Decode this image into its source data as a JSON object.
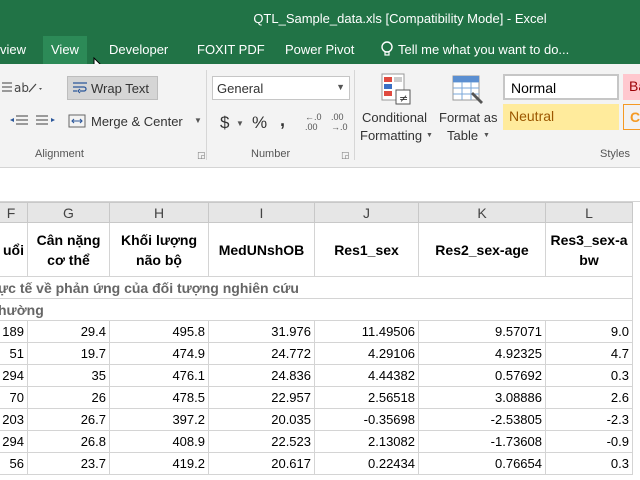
{
  "window": {
    "title": "QTL_Sample_data.xls  [Compatibility Mode] - Excel"
  },
  "tabs": [
    {
      "label": "view",
      "active": false
    },
    {
      "label": "View",
      "active": true
    },
    {
      "label": "Developer",
      "active": false
    },
    {
      "label": "FOXIT PDF",
      "active": false
    },
    {
      "label": "Power Pivot",
      "active": false
    }
  ],
  "tellme": {
    "label": "Tell me what you want to do..."
  },
  "ribbon": {
    "alignment": {
      "wrap_text": "Wrap Text",
      "merge_center": "Merge & Center",
      "group_label": "Alignment"
    },
    "number": {
      "format_value": "General",
      "currency": "$",
      "percent": "%",
      "comma": ",",
      "inc_decimal": "←.0 .00",
      "dec_decimal": ".00 →.0",
      "group_label": "Number"
    },
    "styles": {
      "conditional_1": "Conditional",
      "conditional_2": "Formatting",
      "format_as_1": "Format as",
      "format_as_2": "Table",
      "normal": "Normal",
      "neutral": "Neutral",
      "bad_partial": "Ba",
      "calc_partial": "C",
      "group_label": "Styles"
    },
    "colors": {
      "bad_bg": "#ffc7ce",
      "bad_fg": "#9c0006",
      "neutral_bg": "#ffeb9c",
      "neutral_fg": "#9c5700"
    }
  },
  "sheet": {
    "columns": [
      "F",
      "G",
      "H",
      "I",
      "J",
      "K",
      "L"
    ],
    "headers": [
      "uổi",
      "Cân nặng cơ thể",
      "Khối lượng não bộ",
      "MedUNshOB",
      "Res1_sex",
      "Res2_sex-age",
      "Res3_sex-a bw"
    ],
    "section1": "ực tế về phản ứng của đối tượng nghiên cứu",
    "section2": "hường",
    "rows": [
      [
        "189",
        "29.4",
        "495.8",
        "31.976",
        "11.49506",
        "9.57071",
        "9.0"
      ],
      [
        "51",
        "19.7",
        "474.9",
        "24.772",
        "4.29106",
        "4.92325",
        "4.7"
      ],
      [
        "294",
        "35",
        "476.1",
        "24.836",
        "4.44382",
        "0.57692",
        "0.3"
      ],
      [
        "70",
        "26",
        "478.5",
        "22.957",
        "2.56518",
        "3.08886",
        "2.6"
      ],
      [
        "203",
        "26.7",
        "397.2",
        "20.035",
        "-0.35698",
        "-2.53805",
        "-2.3"
      ],
      [
        "294",
        "26.8",
        "408.9",
        "22.523",
        "2.13082",
        "-1.73608",
        "-0.9"
      ],
      [
        "56",
        "23.7",
        "419.2",
        "20.617",
        "0.22434",
        "0.76654",
        "0.3"
      ]
    ]
  }
}
